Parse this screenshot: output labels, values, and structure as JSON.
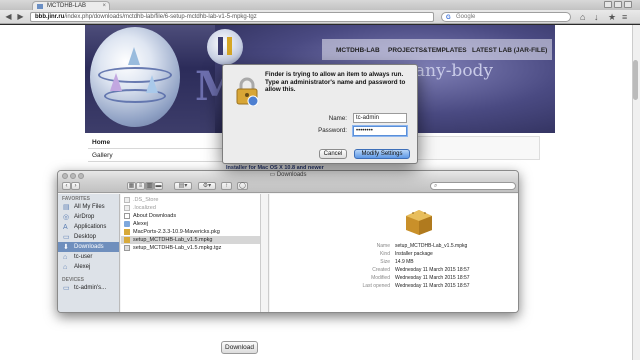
{
  "browser": {
    "tab_title": "MCTDHB-LAB",
    "url_host": "bbb.jinr.ru",
    "url_path": "/index.php/downloads/mctdhb-lab/file/6-setup-mctdhb-lab-v1-5-mpkg-tgz",
    "search_engine": "Google",
    "search_logo": "G"
  },
  "site": {
    "banner_big_letter": "MC",
    "banner_subtitle": "any-body",
    "nav": [
      "MCTDHB-LAB",
      "PROJECTS&TEMPLATES",
      "LATEST LAB (JAR-FILE)"
    ],
    "side_menu": [
      "Home",
      "Gallery"
    ],
    "content_text": "Installer for Mac OS X 10.8 and newer",
    "download_button": "Download"
  },
  "finder": {
    "title": "Downloads",
    "search_placeholder": "",
    "sidebar": {
      "favorites_header": "FAVORITES",
      "favorites": [
        {
          "label": "All My Files",
          "icon": "files-icon"
        },
        {
          "label": "AirDrop",
          "icon": "airdrop-icon"
        },
        {
          "label": "Applications",
          "icon": "applications-icon"
        },
        {
          "label": "Desktop",
          "icon": "desktop-icon"
        },
        {
          "label": "Downloads",
          "icon": "downloads-icon",
          "selected": true
        },
        {
          "label": "tc-user",
          "icon": "home-icon"
        },
        {
          "label": "Alexej",
          "icon": "home-icon"
        }
      ],
      "devices_header": "DEVICES",
      "devices": [
        {
          "label": "tc-admin's...",
          "icon": "computer-icon"
        }
      ]
    },
    "files": [
      {
        "name": ".DS_Store",
        "dim": true
      },
      {
        "name": ".localized",
        "dim": true
      },
      {
        "name": "About Downloads",
        "dim": false
      },
      {
        "name": "Alexej",
        "dim": false
      },
      {
        "name": "MacPorts-2.3.3-10.9-Mavericks.pkg",
        "dim": false
      },
      {
        "name": "setup_MCTDHB-Lab_v1.5.mpkg",
        "dim": false,
        "selected": true
      },
      {
        "name": "setup_MCTDHB-Lab_v1.5.mpkg.tgz",
        "dim": false
      }
    ],
    "preview": {
      "labels": [
        "Name",
        "Kind",
        "Size",
        "Created",
        "Modified",
        "Last opened"
      ],
      "values": [
        "setup_MCTDHB-Lab_v1.5.mpkg",
        "Installer package",
        "14.9 MB",
        "Wednesday 11 March 2015 18:57",
        "Wednesday 11 March 2015 18:57",
        "Wednesday 11 March 2015 18:57"
      ]
    }
  },
  "dialog": {
    "message": "Finder is trying to allow an item to always run. Type an administrator's name and password to allow this.",
    "name_label": "Name:",
    "name_value": "tc-admin",
    "password_label": "Password:",
    "password_value": "••••••••",
    "cancel_label": "Cancel",
    "ok_label": "Modify Settings"
  }
}
